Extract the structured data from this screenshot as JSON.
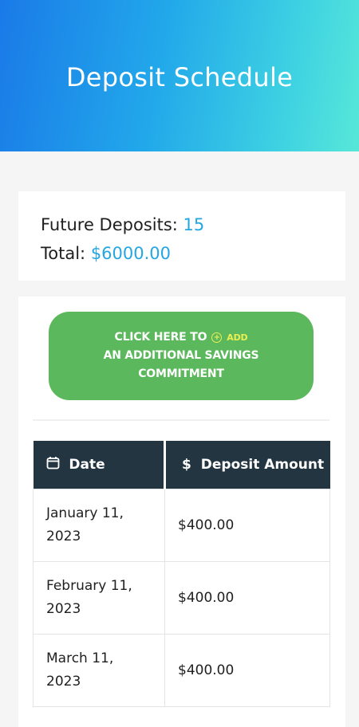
{
  "header": {
    "title": "Deposit Schedule"
  },
  "summary": {
    "future_label": "Future Deposits:",
    "future_value": "15",
    "total_label": "Total:",
    "total_value": "$6000.00",
    "accent_color": "#24a6e3"
  },
  "cta": {
    "line1": "CLICK HERE TO",
    "add_label": "ADD",
    "line2": "AN ADDITIONAL SAVINGS",
    "line3": "COMMITMENT",
    "color": "#5cb85c"
  },
  "table": {
    "headers": [
      {
        "icon": "calendar-icon",
        "label": "Date"
      },
      {
        "icon": "dollar-icon",
        "label": "Deposit Amount"
      }
    ],
    "rows": [
      {
        "date_line1": "January 11,",
        "date_line2": "2023",
        "amount": "$400.00"
      },
      {
        "date_line1": "February 11,",
        "date_line2": "2023",
        "amount": "$400.00"
      },
      {
        "date_line1": "March 11,",
        "date_line2": "2023",
        "amount": "$400.00"
      }
    ]
  }
}
